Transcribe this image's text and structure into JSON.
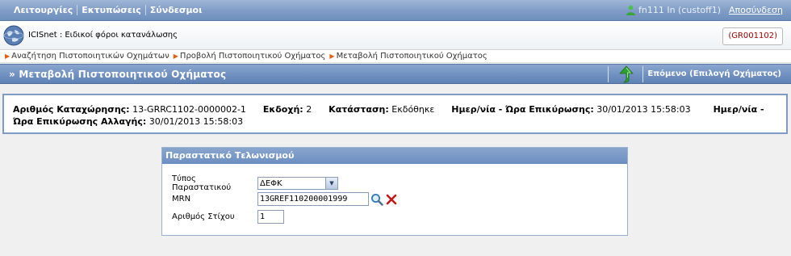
{
  "menu": {
    "items": [
      "Λειτουργίες",
      "Εκτυπώσεις",
      "Σύνδεσμοι"
    ],
    "user": "fn111 In (custoff1)",
    "logout": "Αποσύνδεση"
  },
  "header": {
    "app_title": "ICISnet : Ειδικοί φόροι κατανάλωσης",
    "code": "(GR001102)"
  },
  "breadcrumb": [
    "Αναζήτηση Πιστοποιητικών Οχημάτων",
    "Προβολή Πιστοποιητικού Οχήματος",
    "Μεταβολή Πιστοποιητικού Οχήματος"
  ],
  "titlebar": {
    "title": "» Μεταβολή Πιστοποιητικού Οχήματος",
    "next": "Επόμενο (Επιλογή Οχήματος)"
  },
  "info": {
    "reg_label": "Αριθμός Καταχώρησης:",
    "reg_value": "13-GRRC1102-0000002-1",
    "version_label": "Εκδοχή:",
    "version_value": "2",
    "status_label": "Κατάσταση:",
    "status_value": "Εκδόθηκε",
    "confirm_label": "Ημερ/νία - Ώρα Επικύρωσης:",
    "confirm_value": "30/01/2013 15:58:03",
    "change_label_a": "Ημερ/νία -",
    "change_label_b": "Ώρα Επικύρωσης Αλλαγής:",
    "change_value": "30/01/2013 15:58:03"
  },
  "form": {
    "title": "Παραστατικό Τελωνισμού",
    "doc_type_label": "Τύπος Παραστατικού",
    "doc_type_value": "ΔΕΦΚ",
    "mrn_label": "MRN",
    "mrn_value": "13GREF110200001999",
    "item_label": "Αριθμός Στίχου",
    "item_value": "1"
  },
  "colors": {
    "bar_blue": "#6e8fbf",
    "badge_red": "#a00000",
    "arrow_green": "#2fa02f",
    "delete_red": "#c01818"
  }
}
